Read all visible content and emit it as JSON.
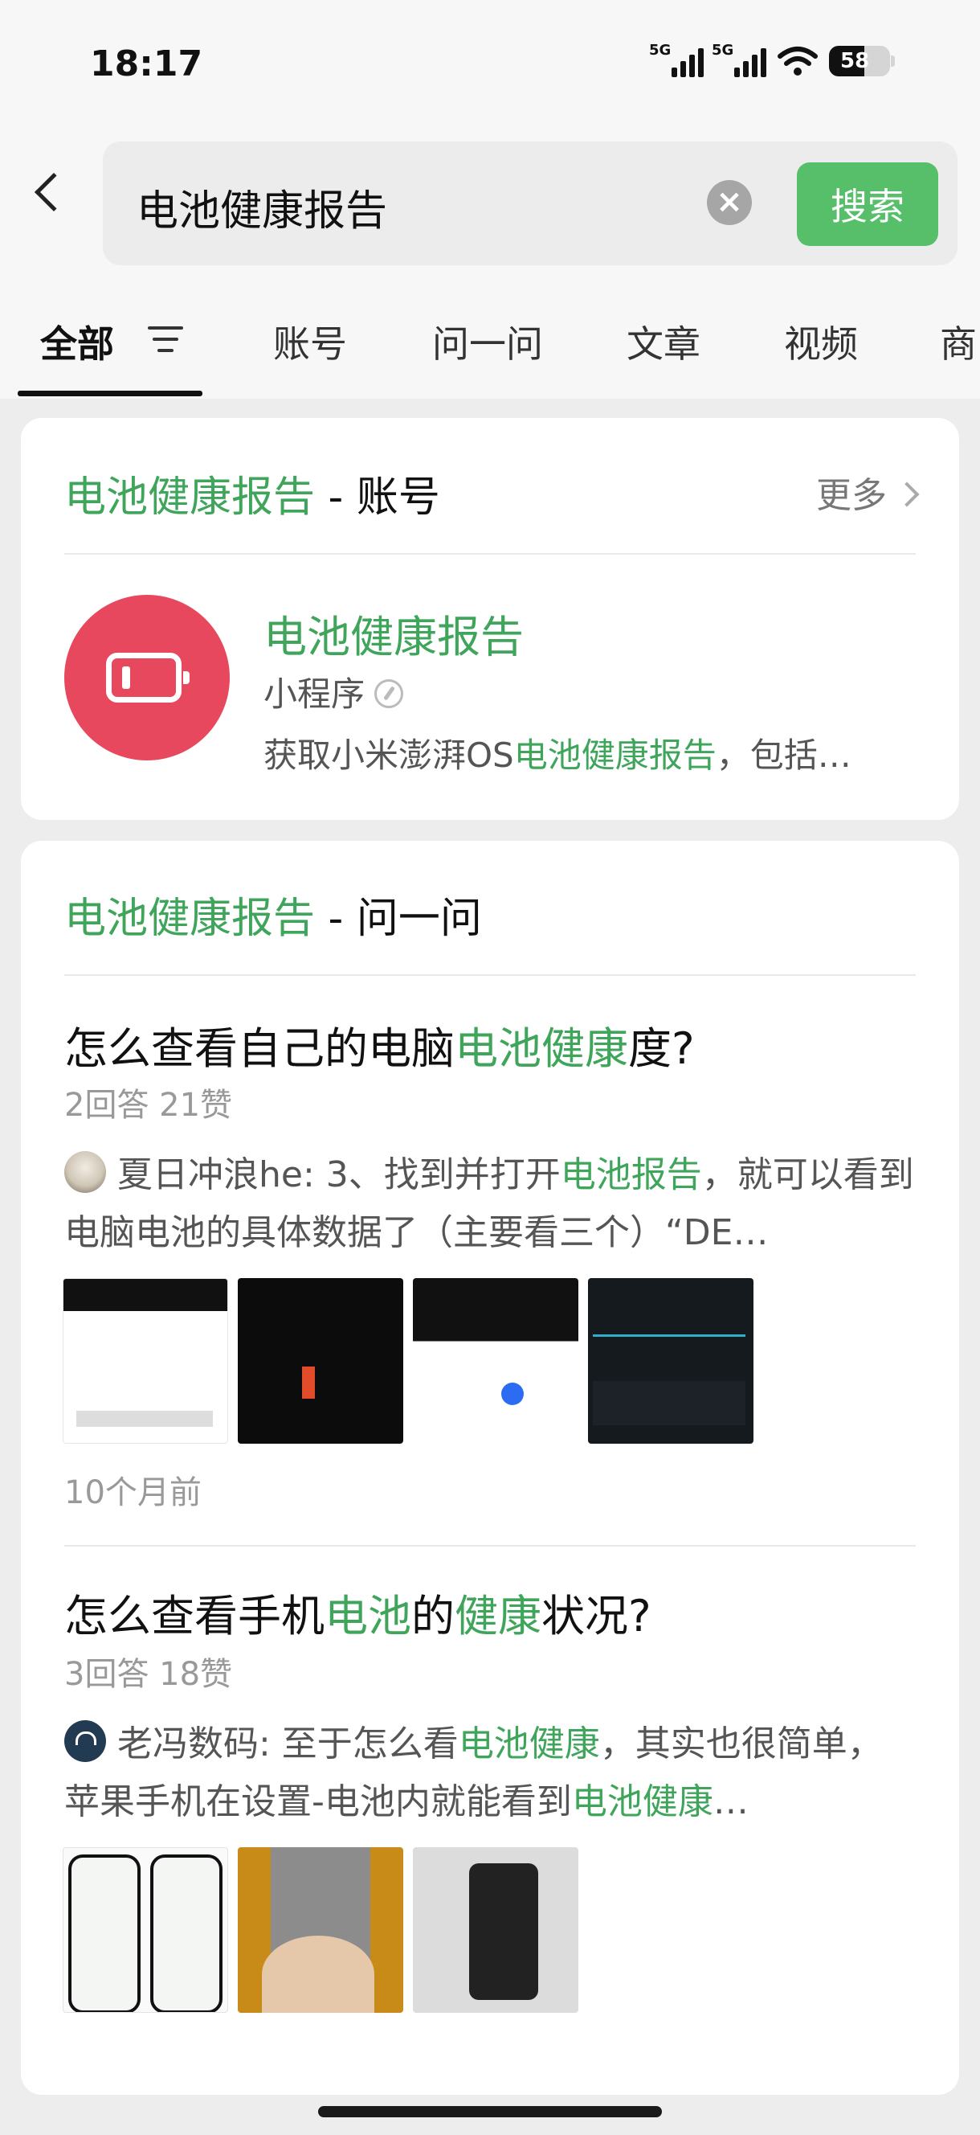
{
  "status_bar": {
    "time": "18:17",
    "net1": "5G",
    "net2": "5G",
    "battery": "58"
  },
  "search": {
    "query": "电池健康报告",
    "button": "搜索"
  },
  "tabs": [
    "全部",
    "账号",
    "问一问",
    "文章",
    "视频",
    "商"
  ],
  "account_section": {
    "title_keyword": "电池健康报告",
    "title_suffix": " - 账号",
    "more": "更多",
    "account": {
      "name": "电池健康报告",
      "type": "小程序",
      "desc_prefix": "获取小米澎湃OS",
      "desc_highlight": "电池健康报告",
      "desc_suffix": "，包括…"
    }
  },
  "ask_section": {
    "title_keyword": "电池健康报告",
    "title_suffix": " - 问一问",
    "questions": [
      {
        "title_a": "怎么查看自己的电脑",
        "title_hl": "电池健康",
        "title_b": "度?",
        "stats": "2回答 21赞",
        "ans_a": "夏日冲浪he: 3、找到并打开",
        "ans_hl1": "电池报告",
        "ans_b": "，就可以看到电脑电池的具体数据了（主要看三个）“DE…",
        "time": "10个月前"
      },
      {
        "title_a": "怎么查看手机",
        "title_hl1": "电池",
        "title_b": "的",
        "title_hl2": "健康",
        "title_c": "状况?",
        "stats": "3回答 18赞",
        "ans_a": "老冯数码: 至于怎么看",
        "ans_hl1": "电池健康",
        "ans_b": "，其实也很简单，苹果手机在设置-电池内就能看到",
        "ans_hl2": "电池健康",
        "ans_c": "…"
      }
    ]
  }
}
